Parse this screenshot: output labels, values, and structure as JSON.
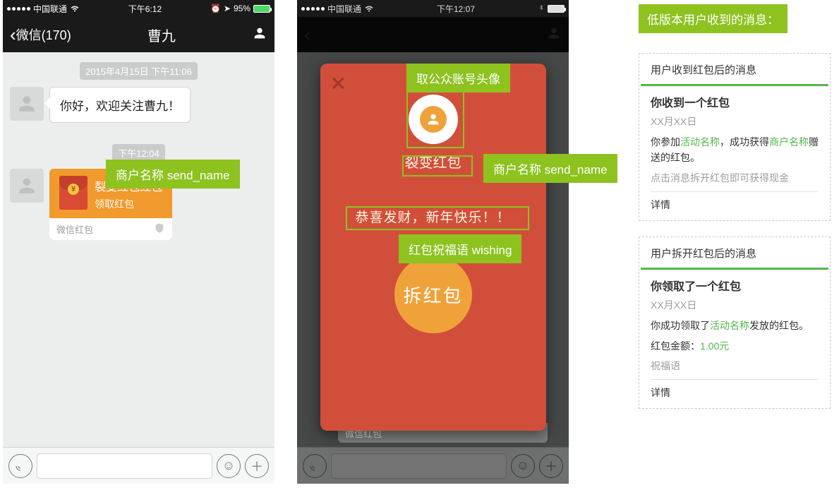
{
  "phone1": {
    "status": {
      "carrier": "中国联通",
      "time": "下午6:12",
      "battery": "95%"
    },
    "nav": {
      "back": "微信(170)",
      "title": "曹九"
    },
    "timestamp1": "2015年4月15日 下午11:06",
    "msg1": "你好，欢迎关注曹九！",
    "timestamp2": "下午12:04",
    "redpacket": {
      "title": "裂变红包红包",
      "sub": "领取红包",
      "footer": "微信红包"
    },
    "callout_merchant": "商户名称 send_name"
  },
  "phone2": {
    "status": {
      "carrier": "中国联通",
      "time": "下午12:07"
    },
    "modal": {
      "merchant": "裂变红包",
      "wish": "恭喜发财，新年快乐！！",
      "open": "拆红包",
      "footer": "微信红包"
    },
    "callout_avatar": "取公众账号头像",
    "callout_merchant": "商户名称 send_name",
    "callout_wish": "红包祝福语 wishing"
  },
  "right": {
    "header": "低版本用户收到的消息：",
    "card1": {
      "head": "用户收到红包后的消息",
      "title": "你收到一个红包",
      "date": "XX月XX日",
      "line_pre": "你参加",
      "activity": "活动名称",
      "line_mid": "，成功获得",
      "merchant": "商户名称",
      "line_post": "赠送的红包。",
      "hint": "点击消息拆开红包即可获得现金",
      "details": "详情"
    },
    "card2": {
      "head": "用户拆开红包后的消息",
      "title": "你领取了一个红包",
      "date": "XX月XX日",
      "line_pre": "你成功领取了",
      "activity": "活动名称",
      "line_post": "发放的红包。",
      "amount_label": "红包金额：",
      "amount": "1.00元",
      "wish": "祝福语",
      "details": "详情"
    }
  }
}
